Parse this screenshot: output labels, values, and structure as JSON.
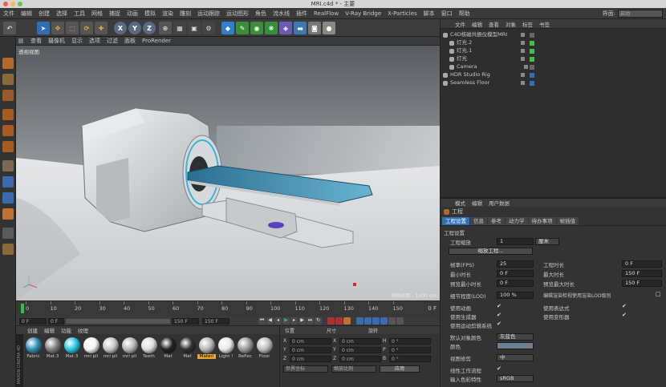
{
  "window": {
    "title": "MRI.c4d * - 主要"
  },
  "menu": {
    "items": [
      "文件",
      "编辑",
      "创建",
      "选择",
      "工具",
      "网格",
      "捕捉",
      "动画",
      "模拟",
      "渲染",
      "雕刻",
      "运动跟踪",
      "运动图形",
      "角色",
      "流水线",
      "插件",
      "RealFlow",
      "V-Ray Bridge",
      "X-Particles",
      "脚本",
      "窗口",
      "帮助"
    ],
    "layout_label": "界面:",
    "layout_value": "启动"
  },
  "viewport": {
    "menu": [
      "查看",
      "摄像机",
      "显示",
      "选项",
      "过滤",
      "面板",
      "ProRender"
    ],
    "view_label": "透视视图",
    "grid_info": "网格间距 : 1000 cm"
  },
  "timeline": {
    "ticks": [
      "0",
      "10",
      "20",
      "30",
      "40",
      "50",
      "60",
      "70",
      "80",
      "90",
      "100",
      "110",
      "120",
      "130",
      "140",
      "150"
    ],
    "frame_indicator": "0 F"
  },
  "playback": {
    "start": "0 F",
    "current": "0 F",
    "end": "150 F",
    "max": "150 F"
  },
  "materials": {
    "menu": [
      "创建",
      "编辑",
      "功能",
      "纹理"
    ],
    "items": [
      "Fabric",
      "Mat.3",
      "Mat.3",
      "mri pli",
      "mri pli",
      "mri pli",
      "Teeth",
      "Mat",
      "Mat",
      "Materi",
      "Light !",
      "Reflec",
      "Floor"
    ],
    "brand": "MAXON CINEMA 4D"
  },
  "coords": {
    "headers": [
      "位置",
      "尺寸",
      "旋转"
    ],
    "rows": [
      {
        "a": "X",
        "av": "0 cm",
        "b": "X",
        "bv": "0 cm",
        "c": "H",
        "cv": "0 °"
      },
      {
        "a": "Y",
        "av": "0 cm",
        "b": "Y",
        "bv": "0 cm",
        "c": "P",
        "cv": "0 °"
      },
      {
        "a": "Z",
        "av": "0 cm",
        "b": "Z",
        "bv": "0 cm",
        "c": "B",
        "cv": "0 °"
      }
    ],
    "mode_world": "世界坐标",
    "mode_scale": "缩放比例",
    "apply": "应用"
  },
  "objects": {
    "menu": [
      "文件",
      "编辑",
      "查看",
      "对象",
      "标签",
      "书签"
    ],
    "items": [
      {
        "name": "C4D核磁共振仪模型MRI",
        "indent": 0
      },
      {
        "name": "灯光.2",
        "indent": 1
      },
      {
        "name": "灯光.1",
        "indent": 1
      },
      {
        "name": "灯光",
        "indent": 1
      },
      {
        "name": "Camera",
        "indent": 1
      },
      {
        "name": "HDR Studio Rig",
        "indent": 0
      },
      {
        "name": "Seamless Floor",
        "indent": 0
      }
    ]
  },
  "attributes": {
    "menu": [
      "模式",
      "编辑",
      "用户数据"
    ],
    "title": "工程",
    "tabs": [
      "工程设置",
      "信息",
      "参考",
      "动力学",
      "待办事项",
      "帧插值"
    ],
    "section": "工程设置",
    "scale_label": "工程缩放",
    "scale_value": "1",
    "scale_unit": "厘米",
    "scale_button": "缩放工程...",
    "fps_label": "帧率(FPS)",
    "fps_value": "25",
    "duration_label": "工程时长",
    "duration_value": "0 F",
    "min_time_label": "最小时长",
    "min_time_value": "0 F",
    "max_time_label": "最大时长",
    "max_time_value": "150 F",
    "preview_min_label": "预览最小时长",
    "preview_min_value": "0 F",
    "preview_max_label": "预览最大时长",
    "preview_max_value": "150 F",
    "lod_label": "细节程度(LOD)",
    "lod_value": "100 %",
    "lod_check_label": "编辑渲染检视使用渲染LOD级别",
    "use_anim": "使用动画",
    "use_expr": "使用表达式",
    "use_gen": "使用生成器",
    "use_deform": "使用变形器",
    "use_motion": "使用运动剪辑系统",
    "default_color_label": "默认对象颜色",
    "default_color_value": "灰蓝色",
    "color_label": "颜色",
    "view_clip_label": "视图修剪",
    "view_clip_value": "中",
    "linear_label": "线性工作流程",
    "input_color_label": "输入色彩特性",
    "input_color_value": "sRGB"
  }
}
